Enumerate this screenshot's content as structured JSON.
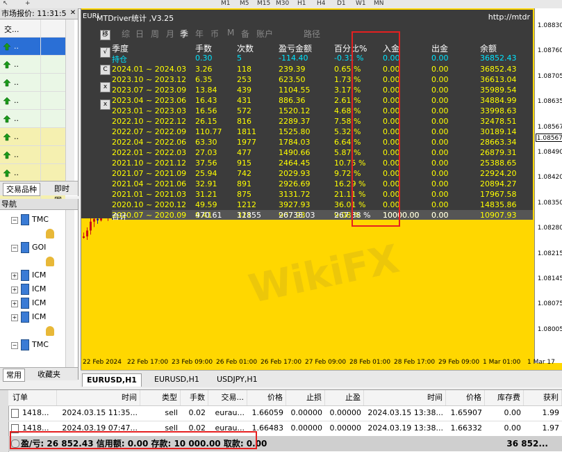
{
  "toolbar": {
    "items": [
      "M1",
      "M5",
      "M15",
      "M30",
      "H1",
      "H4",
      "D1",
      "W1",
      "MN"
    ]
  },
  "market_watch": {
    "title": "市场报价: 11:31:5",
    "header": "交...",
    "rows": [
      "..",
      "..",
      "..",
      "..",
      "..",
      "..",
      "..",
      "..",
      "..",
      ".."
    ],
    "tabs": [
      "交易品种",
      "即时图"
    ]
  },
  "navigator": {
    "title": "导航",
    "items": [
      "TMC",
      "",
      "GOI",
      "",
      "ICM",
      "ICM",
      "ICM",
      "ICM",
      "",
      "TMC"
    ],
    "tabs": [
      "常用",
      "收藏夹"
    ]
  },
  "stats": {
    "title": "MTDriver统计 ,V3.25",
    "url": "http://mtdr",
    "side_buttons": [
      "移",
      "√",
      "C",
      "x",
      "x"
    ],
    "tabs": [
      "综",
      "日",
      "周",
      "月",
      "季",
      "年",
      "币",
      "M",
      "备",
      "账户",
      "路径"
    ],
    "active_tab": "季",
    "headers": [
      "季度",
      "手数",
      "次数",
      "盈亏金额",
      "百分比%",
      "入金",
      "出金",
      "余额"
    ],
    "holding": [
      "持仓",
      "0.30",
      "5",
      "-114.40",
      "-0.31 %",
      "0.00",
      "0.00",
      "36852.43"
    ],
    "rows": [
      [
        "2024.01 ~ 2024.03",
        "3.26",
        "118",
        "239.39",
        "0.65 %",
        "0.00",
        "0.00",
        "36852.43"
      ],
      [
        "2023.10 ~ 2023.12",
        "6.35",
        "253",
        "623.50",
        "1.73 %",
        "0.00",
        "0.00",
        "36613.04"
      ],
      [
        "2023.07 ~ 2023.09",
        "13.84",
        "439",
        "1104.55",
        "3.17 %",
        "0.00",
        "0.00",
        "35989.54"
      ],
      [
        "2023.04 ~ 2023.06",
        "16.43",
        "431",
        "886.36",
        "2.61 %",
        "0.00",
        "0.00",
        "34884.99"
      ],
      [
        "2023.01 ~ 2023.03",
        "16.56",
        "572",
        "1520.12",
        "4.68 %",
        "0.00",
        "0.00",
        "33998.63"
      ],
      [
        "2022.10 ~ 2022.12",
        "26.15",
        "816",
        "2289.37",
        "7.58 %",
        "0.00",
        "0.00",
        "32478.51"
      ],
      [
        "2022.07 ~ 2022.09",
        "110.77",
        "1811",
        "1525.80",
        "5.32 %",
        "0.00",
        "0.00",
        "30189.14"
      ],
      [
        "2022.04 ~ 2022.06",
        "63.30",
        "1977",
        "1784.03",
        "6.64 %",
        "0.00",
        "0.00",
        "28663.34"
      ],
      [
        "2022.01 ~ 2022.03",
        "27.03",
        "477",
        "1490.66",
        "5.87 %",
        "0.00",
        "0.00",
        "26879.31"
      ],
      [
        "2021.10 ~ 2021.12",
        "37.56",
        "915",
        "2464.45",
        "10.75 %",
        "0.00",
        "0.00",
        "25388.65"
      ],
      [
        "2021.07 ~ 2021.09",
        "25.94",
        "742",
        "2029.93",
        "9.72 %",
        "0.00",
        "0.00",
        "22924.20"
      ],
      [
        "2021.04 ~ 2021.06",
        "32.91",
        "891",
        "2926.69",
        "16.29 %",
        "0.00",
        "0.00",
        "20894.27"
      ],
      [
        "2021.01 ~ 2021.03",
        "31.21",
        "875",
        "3131.72",
        "21.11 %",
        "0.00",
        "0.00",
        "17967.58"
      ],
      [
        "2020.10 ~ 2020.12",
        "49.59",
        "1212",
        "3927.93",
        "36.01 %",
        "0.00",
        "0.00",
        "14835.86"
      ],
      [
        "2020.07 ~ 2020.09",
        "9.41",
        "321",
        "907.93",
        "9.08 %",
        "10000.00",
        "0.00",
        "10907.93"
      ]
    ],
    "total": [
      "合计",
      "470.61",
      "11855",
      "26738.03",
      "267.38 %",
      "10000.00",
      "0.00",
      ""
    ]
  },
  "chart": {
    "symbol": "EURI",
    "price_labels": [
      "1.08830",
      "1.08760",
      "1.08705",
      "1.08635",
      "1.08567",
      "1.08490",
      "1.08420",
      "1.08350",
      "1.08280",
      "1.08215",
      "1.08145",
      "1.08075",
      "1.08005"
    ],
    "current_price": "1.08567",
    "time_labels": [
      "22 Feb 2024",
      "22 Feb 17:00",
      "23 Feb 09:00",
      "26 Feb 01:00",
      "26 Feb 17:00",
      "27 Feb 09:00",
      "28 Feb 01:00",
      "28 Feb 17:00",
      "29 Feb 09:00",
      "1 Mar 01:00",
      "1 Mar 17"
    ],
    "watermark": "WikiFX"
  },
  "chart_tabs": [
    "EURUSD,H1",
    "EURUSD,H1",
    "USDJPY,H1"
  ],
  "terminal": {
    "headers": [
      "订单",
      "时间",
      "类型",
      "手数",
      "交易...",
      "价格",
      "止损",
      "止盈",
      "时间",
      "价格",
      "库存费",
      "获利"
    ],
    "rows": [
      [
        "1418...",
        "2024.03.15 11:35...",
        "sell",
        "0.02",
        "eurau...",
        "1.66059",
        "0.00000",
        "0.00000",
        "2024.03.15 13:38...",
        "1.65907",
        "0.00",
        "1.99"
      ],
      [
        "1418...",
        "2024.03.19 07:47...",
        "sell",
        "0.02",
        "eurau...",
        "1.66483",
        "0.00000",
        "0.00000",
        "2024.03.19 13:38...",
        "1.66332",
        "0.00",
        "1.97"
      ]
    ],
    "balance": "盈/亏: 26 852.43  信用额: 0.00  存款: 10 000.00  取款: 0.00",
    "balance_total": "36 852..."
  }
}
